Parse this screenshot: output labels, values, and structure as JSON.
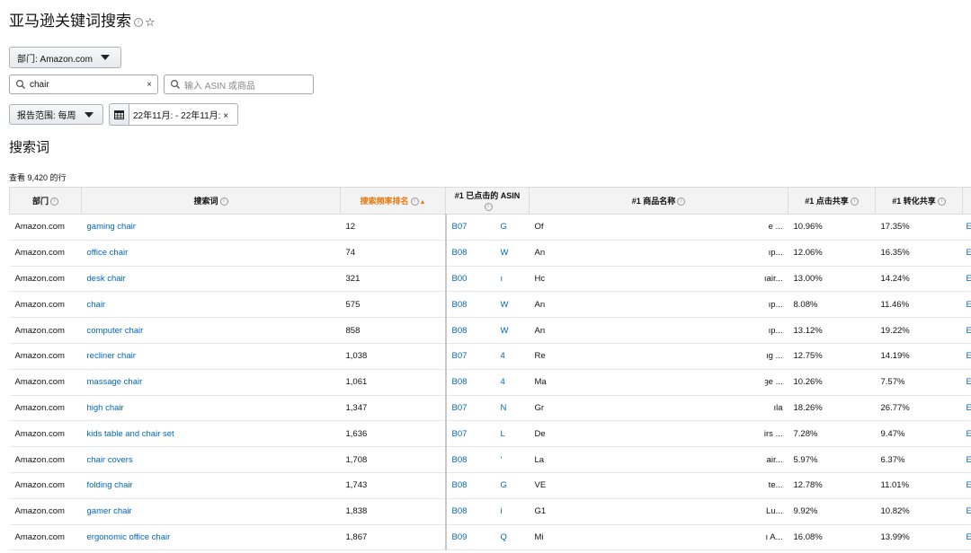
{
  "title": "亚马逊关键词搜索",
  "info_glyph": "i",
  "star_glyph": "☆",
  "department_button": "部门: Amazon.com",
  "search": {
    "value": "chair",
    "clear": "×"
  },
  "asin_search": {
    "placeholder": "输入 ASIN 或商品"
  },
  "report_range_button": "报告范围: 每周",
  "date_range": "22年11月: - 22年11月: ×",
  "section_title": "搜索词",
  "row_count": "查看 9,420 的行",
  "columns": [
    "部门",
    "搜索词",
    "搜索频率排名",
    "#1 已点击的 ASIN",
    "#1 商品名称",
    "#1 点击共享",
    "#1 转化共享"
  ],
  "sort_indicator": "▲",
  "rows": [
    {
      "dept": "Amazon.com",
      "term": "gaming chair",
      "rank": "12",
      "asin_a": "B07",
      "asin_b": "G",
      "name_a": "Of",
      "name_b": "e ...",
      "click": "10.96%",
      "conv": "17.35%"
    },
    {
      "dept": "Amazon.com",
      "term": "office chair",
      "rank": "74",
      "asin_a": "B08",
      "asin_b": "W",
      "name_a": "An",
      "name_b": "ıp...",
      "click": "12.06%",
      "conv": "16.35%"
    },
    {
      "dept": "Amazon.com",
      "term": "desk chair",
      "rank": "321",
      "asin_a": "B00",
      "asin_b": "ı",
      "name_a": "Hc",
      "name_b": "ıair...",
      "click": "13.00%",
      "conv": "14.24%"
    },
    {
      "dept": "Amazon.com",
      "term": "chair",
      "rank": "575",
      "asin_a": "B08",
      "asin_b": "W",
      "name_a": "An",
      "name_b": "ıp...",
      "click": "8.08%",
      "conv": "11.46%"
    },
    {
      "dept": "Amazon.com",
      "term": "computer chair",
      "rank": "858",
      "asin_a": "B08",
      "asin_b": "W",
      "name_a": "An",
      "name_b": "ıp...",
      "click": "13.12%",
      "conv": "19.22%"
    },
    {
      "dept": "Amazon.com",
      "term": "recliner chair",
      "rank": "1,038",
      "asin_a": "B07",
      "asin_b": "4",
      "name_a": "Re",
      "name_b": "ıg ...",
      "click": "12.75%",
      "conv": "14.19%"
    },
    {
      "dept": "Amazon.com",
      "term": "massage chair",
      "rank": "1,061",
      "asin_a": "B08",
      "asin_b": "4",
      "name_a": "Ma",
      "name_b": "ȝe ...",
      "click": "10.26%",
      "conv": "7.57%"
    },
    {
      "dept": "Amazon.com",
      "term": "high chair",
      "rank": "1,347",
      "asin_a": "B07",
      "asin_b": "N",
      "name_a": "Gr",
      "name_b": "ıla",
      "click": "18.26%",
      "conv": "26.77%"
    },
    {
      "dept": "Amazon.com",
      "term": "kids table and chair set",
      "rank": "1,636",
      "asin_a": "B07",
      "asin_b": "L",
      "name_a": "De",
      "name_b": "irs ...",
      "click": "7.28%",
      "conv": "9.47%"
    },
    {
      "dept": "Amazon.com",
      "term": "chair covers",
      "rank": "1,708",
      "asin_a": "B08",
      "asin_b": "'",
      "name_a": "La",
      "name_b": "air...",
      "click": "5.97%",
      "conv": "6.37%"
    },
    {
      "dept": "Amazon.com",
      "term": "folding chair",
      "rank": "1,743",
      "asin_a": "B08",
      "asin_b": "G",
      "name_a": "VE",
      "name_b": "te...",
      "click": "12.78%",
      "conv": "11.01%"
    },
    {
      "dept": "Amazon.com",
      "term": "gamer chair",
      "rank": "1,838",
      "asin_a": "B08",
      "asin_b": "i",
      "name_a": "G1",
      "name_b": "Lu...",
      "click": "9.92%",
      "conv": "10.82%"
    },
    {
      "dept": "Amazon.com",
      "term": "ergonomic office chair",
      "rank": "1,867",
      "asin_a": "B09",
      "asin_b": "Q",
      "name_a": "Mi",
      "name_b": "ı A...",
      "click": "16.08%",
      "conv": "13.99%"
    }
  ],
  "edge_glyph": "E"
}
